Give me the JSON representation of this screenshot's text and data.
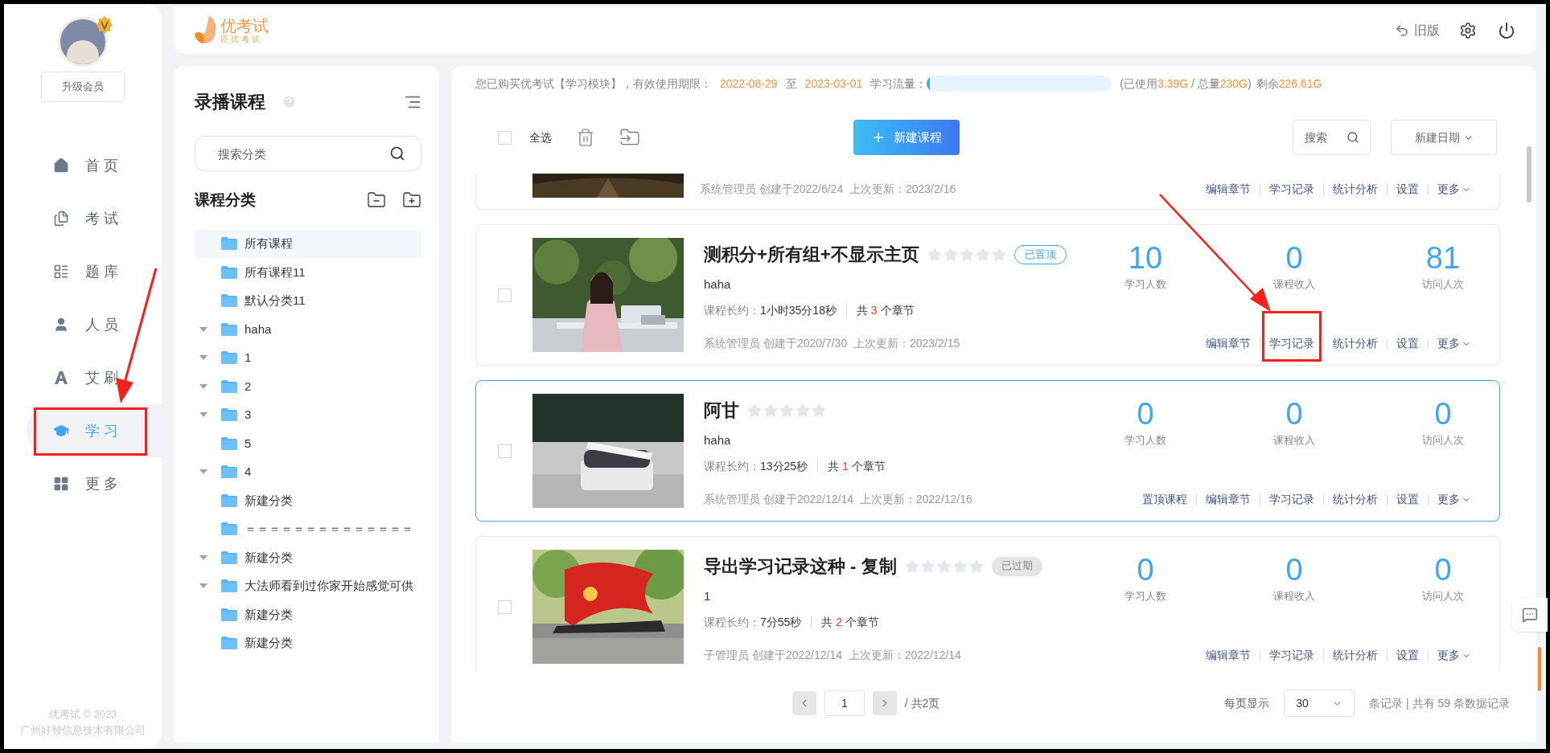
{
  "header": {
    "logo_text": "优考试",
    "logo_slogan": "臣优考试",
    "old_version": "旧版"
  },
  "sidebar": {
    "upgrade": "升级会员",
    "items": [
      {
        "label": "首 页",
        "selected": false
      },
      {
        "label": "考 试",
        "selected": false
      },
      {
        "label": "题 库",
        "selected": false
      },
      {
        "label": "人 员",
        "selected": false
      },
      {
        "label": "艾 刷",
        "selected": false
      },
      {
        "label": "学 习",
        "selected": true
      },
      {
        "label": "更 多",
        "selected": false
      }
    ],
    "footer": [
      "优考试 © 2023",
      "广州好智信息技术有限公司"
    ]
  },
  "category_panel": {
    "title": "录播课程",
    "search_placeholder": "搜索分类",
    "section_title": "课程分类",
    "tree": [
      {
        "label": "所有课程",
        "kind": "leaf",
        "selected": true
      },
      {
        "label": "所有课程11",
        "kind": "leaf",
        "selected": false
      },
      {
        "label": "默认分类11",
        "kind": "leaf",
        "selected": false
      },
      {
        "label": "haha",
        "kind": "branch",
        "selected": false
      },
      {
        "label": "1",
        "kind": "branch",
        "selected": false
      },
      {
        "label": "2",
        "kind": "branch",
        "selected": false
      },
      {
        "label": "3",
        "kind": "branch",
        "selected": false
      },
      {
        "label": "5",
        "kind": "leaf",
        "selected": false
      },
      {
        "label": "4",
        "kind": "branch",
        "selected": false
      },
      {
        "label": "新建分类",
        "kind": "leaf",
        "selected": false
      },
      {
        "label": "＝＝＝＝＝＝＝＝＝＝＝＝＝＝",
        "kind": "leaf",
        "selected": false
      },
      {
        "label": "新建分类",
        "kind": "branch",
        "selected": false
      },
      {
        "label": "大法师看到过你家开始感觉可供",
        "kind": "branch",
        "selected": false
      },
      {
        "label": "新建分类",
        "kind": "leaf",
        "selected": false
      },
      {
        "label": "新建分类",
        "kind": "leaf",
        "selected": false
      }
    ]
  },
  "notice": [
    {
      "text": "您已购买优考试【学习模块】，有效使用期限：",
      "highlight": false
    },
    {
      "text": "2022-08-29",
      "highlight": true
    },
    {
      "text": "至",
      "highlight": false
    },
    {
      "text": "2023-03-01",
      "highlight": true
    },
    {
      "text": "学习流量：",
      "highlight": false
    }
  ],
  "traffic": {
    "level": 0.015
  },
  "usage": [
    {
      "text": "(已使用",
      "highlight": false
    },
    {
      "text": "3.39G",
      "highlight": true
    },
    {
      "text": " / 总量",
      "highlight": false
    },
    {
      "text": "230G",
      "highlight": true
    },
    {
      "text": ")",
      "highlight": false
    },
    {
      "text": "剩余",
      "highlight": false
    },
    {
      "text": "226.61G",
      "highlight": true
    }
  ],
  "toolbar": {
    "select_all": "全选",
    "select_all_checked": false,
    "new_course": "新建课程",
    "search_placeholder": "搜索",
    "sort": "新建日期"
  },
  "courses": [
    {
      "kind": "partial",
      "selected": false,
      "meta": "系统管理员 创建于2022/6/24  上次更新：2023/2/16",
      "actions": [
        {
          "label": "编辑章节",
          "kind": "link"
        },
        {
          "label": "学习记录",
          "kind": "link"
        },
        {
          "label": "统计分析",
          "kind": "link"
        },
        {
          "label": "设置",
          "kind": "link"
        },
        {
          "label": "更多",
          "kind": "menu"
        }
      ]
    },
    {
      "kind": "full",
      "selected": false,
      "checked": false,
      "title": "测积分+所有组+不显示主页",
      "stars": 0,
      "badge": {
        "text": "已置顶",
        "kind": "pinned"
      },
      "description": "haha",
      "duration_label": "课程长约：",
      "duration": "1小时35分18秒",
      "chapters_prefix": "共",
      "chapter_count": "3",
      "chapters_suffix": "个章节",
      "meta": "系统管理员 创建于2020/7/30  上次更新：2023/2/15",
      "stats": [
        {
          "value": "10",
          "label": "学习人数"
        },
        {
          "value": "0",
          "label": "课程收入"
        },
        {
          "value": "81",
          "label": "访问人次"
        }
      ],
      "actions": [
        {
          "label": "编辑章节",
          "kind": "link"
        },
        {
          "label": "学习记录",
          "kind": "link"
        },
        {
          "label": "统计分析",
          "kind": "link"
        },
        {
          "label": "设置",
          "kind": "link"
        },
        {
          "label": "更多",
          "kind": "menu"
        }
      ]
    },
    {
      "kind": "full",
      "selected": true,
      "checked": false,
      "title": "阿甘",
      "stars": 0,
      "description": "haha",
      "duration_label": "课程长约：",
      "duration": "13分25秒",
      "chapters_prefix": "共",
      "chapter_count": "1",
      "chapters_suffix": "个章节",
      "meta": "系统管理员 创建于2022/12/14  上次更新：2022/12/16",
      "stats": [
        {
          "value": "0",
          "label": "学习人数"
        },
        {
          "value": "0",
          "label": "课程收入"
        },
        {
          "value": "0",
          "label": "访问人次"
        }
      ],
      "actions": [
        {
          "label": "置顶课程",
          "kind": "link"
        },
        {
          "label": "编辑章节",
          "kind": "link"
        },
        {
          "label": "学习记录",
          "kind": "link"
        },
        {
          "label": "统计分析",
          "kind": "link"
        },
        {
          "label": "设置",
          "kind": "link"
        },
        {
          "label": "更多",
          "kind": "menu"
        }
      ]
    },
    {
      "kind": "full",
      "selected": false,
      "checked": false,
      "title": "导出学习记录这种 - 复制",
      "stars": 0,
      "badge": {
        "text": "已过期",
        "kind": "expired"
      },
      "description": "1",
      "duration_label": "课程长约：",
      "duration": "7分55秒",
      "chapters_prefix": "共",
      "chapter_count": "2",
      "chapters_suffix": "个章节",
      "meta": "子管理员 创建于2022/12/14  上次更新：2022/12/14",
      "stats": [
        {
          "value": "0",
          "label": "学习人数"
        },
        {
          "value": "0",
          "label": "课程收入"
        },
        {
          "value": "0",
          "label": "访问人次"
        }
      ],
      "actions": [
        {
          "label": "编辑章节",
          "kind": "link"
        },
        {
          "label": "学习记录",
          "kind": "link"
        },
        {
          "label": "统计分析",
          "kind": "link"
        },
        {
          "label": "设置",
          "kind": "link"
        },
        {
          "label": "更多",
          "kind": "menu"
        }
      ]
    }
  ],
  "pagination": {
    "page": "1",
    "total_pages": "/ 共2页",
    "per_page_label": "每页显示",
    "per_page": "30",
    "summary": "条记录 | 共有 59 条数据记录"
  }
}
